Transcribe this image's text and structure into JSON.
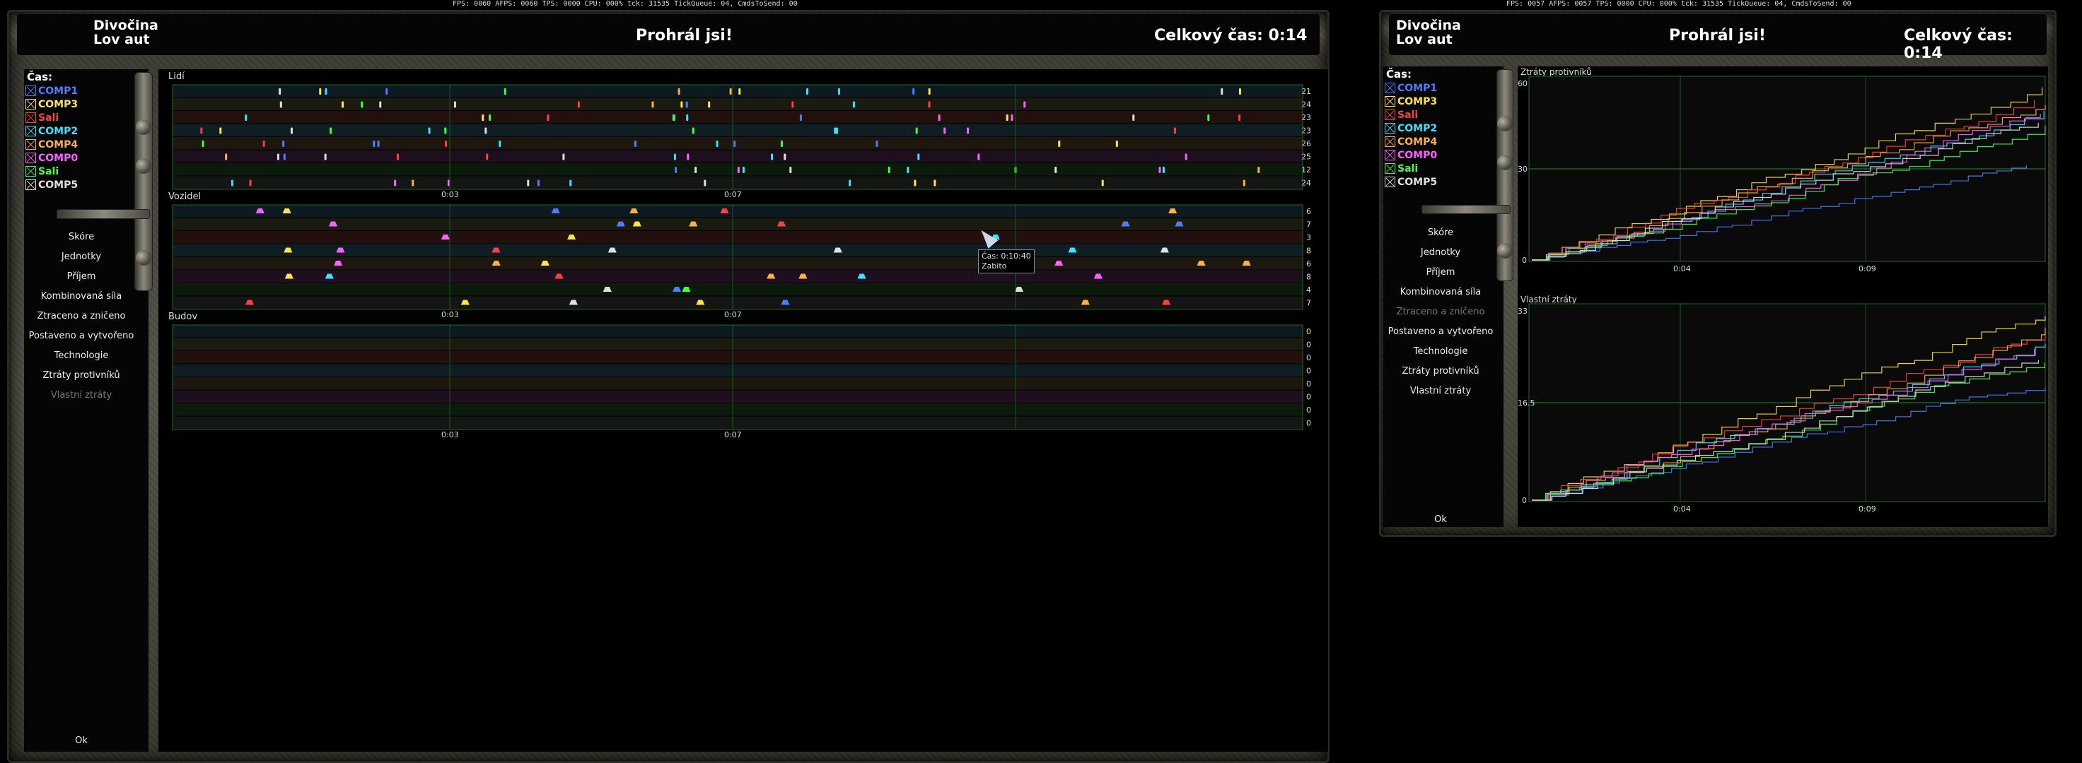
{
  "debug_left": "FPS: 0060 AFPS: 0060 TPS: 0000 CPU: 000% tck: 31535 TickQueue: 04, CmdsToSend: 00",
  "debug_right": "FPS: 0057 AFPS: 0057 TPS: 0000 CPU: 000% tck: 31535 TickQueue: 04, CmdsToSend: 00",
  "left": {
    "map_line1": "Divočina",
    "map_line2": "Lov aut",
    "result": "Prohrál jsi!",
    "total_time": "Celkový čas: 0:14",
    "legend_title": "Čas:",
    "legend": [
      {
        "name": "COMP1",
        "color": "#4d7dff"
      },
      {
        "name": "COMP3",
        "color": "#ffe44d"
      },
      {
        "name": "Sali",
        "color": "#ff4040"
      },
      {
        "name": "COMP2",
        "color": "#40e0ff"
      },
      {
        "name": "COMP4",
        "color": "#ffb040"
      },
      {
        "name": "COMP0",
        "color": "#ff60ff"
      },
      {
        "name": "Sali",
        "color": "#40ff40"
      },
      {
        "name": "COMP5",
        "color": "#e0e0e0"
      }
    ],
    "menu": [
      {
        "label": "Skóre",
        "dim": false
      },
      {
        "label": "Jednotky",
        "dim": false
      },
      {
        "label": "Příjem",
        "dim": false
      },
      {
        "label": "Kombinovaná síla",
        "dim": false
      },
      {
        "label": "Ztraceno a zničeno",
        "dim": false
      },
      {
        "label": "Postaveno a vytvořeno",
        "dim": false
      },
      {
        "label": "Technologie",
        "dim": false
      },
      {
        "label": "Ztráty protivníků",
        "dim": false
      },
      {
        "label": "Vlastní ztráty",
        "dim": true
      }
    ],
    "ok": "Ok",
    "sections": [
      {
        "title": "Lidí",
        "counts": [
          "21",
          "24",
          "23",
          "23",
          "26",
          "25",
          "12",
          "24"
        ]
      },
      {
        "title": "Vozidel",
        "counts": [
          "6",
          "7",
          "3",
          "8",
          "6",
          "8",
          "4",
          "7"
        ]
      },
      {
        "title": "Budov",
        "counts": [
          "0",
          "0",
          "0",
          "0",
          "0",
          "0",
          "0",
          "0"
        ]
      }
    ],
    "time_ticks": [
      "0:03",
      "0:07"
    ],
    "tooltip_line1": "Čas: 0:10:40",
    "tooltip_line2": "Zabito"
  },
  "right": {
    "map_line1": "Divočina",
    "map_line2": "Lov aut",
    "result": "Prohrál jsi!",
    "total_time": "Celkový čas: 0:14",
    "legend_title": "Čas:",
    "menu": [
      {
        "label": "Skóre",
        "dim": false
      },
      {
        "label": "Jednotky",
        "dim": false
      },
      {
        "label": "Příjem",
        "dim": false
      },
      {
        "label": "Kombinovaná síla",
        "dim": false
      },
      {
        "label": "Ztraceno a zničeno",
        "dim": true
      },
      {
        "label": "Postaveno a vytvořeno",
        "dim": false
      },
      {
        "label": "Technologie",
        "dim": false
      },
      {
        "label": "Ztráty protivníků",
        "dim": false
      },
      {
        "label": "Vlastní ztráty",
        "dim": false
      }
    ],
    "ok": "Ok",
    "charts": [
      {
        "title": "Ztráty protivníků",
        "ymax_label": "60",
        "ymid_label": "30",
        "ymin_label": "0",
        "xticks": [
          "0:04",
          "0:09"
        ]
      },
      {
        "title": "Vlastní ztráty",
        "ymax_label": "33",
        "ymid_label": "16.5",
        "ymin_label": "0",
        "xticks": [
          "0:04",
          "0:09"
        ]
      }
    ]
  }
}
